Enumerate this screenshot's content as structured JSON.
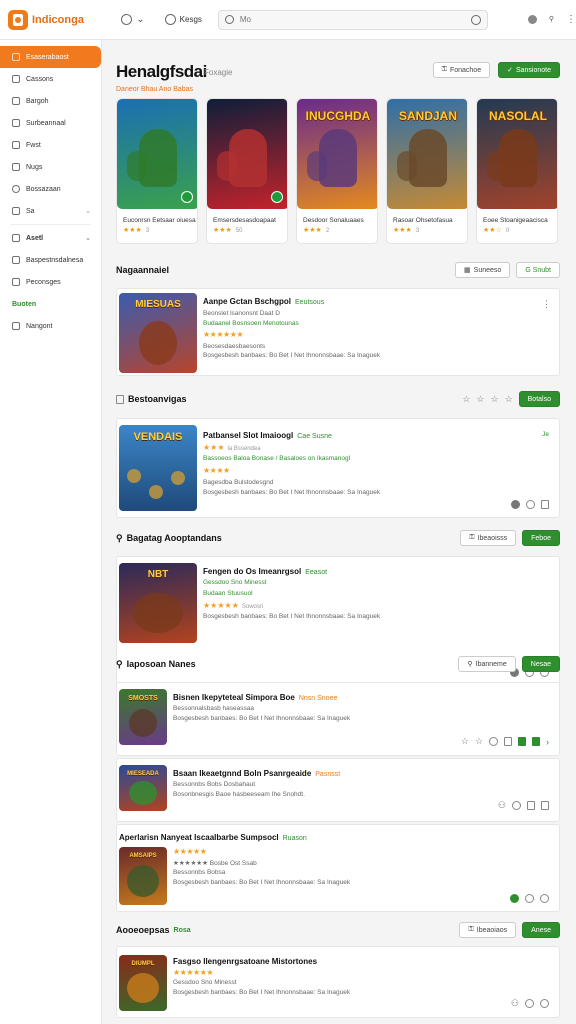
{
  "topbar": {
    "logo_text": "Indiconga",
    "nav1_label": "",
    "nav2_label": "Kesgs",
    "search_placeholder": "Mo"
  },
  "sidebar": {
    "items": [
      {
        "label": "Esaserabaost",
        "active": true
      },
      {
        "label": "Cassons"
      },
      {
        "label": "Bargoh"
      },
      {
        "label": "Surbeannaal"
      },
      {
        "label": "Fwst"
      },
      {
        "label": "Nugs"
      },
      {
        "label": "Bossazaan"
      },
      {
        "label": "Sa"
      },
      {
        "label": "Asetl"
      },
      {
        "label": "Baspestnsdalnesa"
      },
      {
        "label": "Peconsges"
      },
      {
        "label": "Buoten"
      },
      {
        "label": "Nangont"
      }
    ]
  },
  "hero": {
    "title": "Henalgfsdai",
    "subtitle": "Foxagie",
    "tagline": "Daneor Bhau Ano Babas",
    "action1": "Fonachoe",
    "action2": "Sansionote"
  },
  "carousel": [
    {
      "name": "Euconrsn Eetsaar oiuesa",
      "art_word": "",
      "rating": "3",
      "c1": "#1b6fb3",
      "c2": "#3aa14b",
      "f": "#2f7a2a"
    },
    {
      "name": "Emsersdesasdoapaat",
      "art_word": "",
      "rating": "50",
      "c1": "#0e1e3a",
      "c2": "#c4232b",
      "f": "#b33030"
    },
    {
      "name": "Desdoor Sonaluaaes",
      "art_word": "INUCGHDA",
      "rating": "2",
      "c1": "#6a2a8c",
      "c2": "#e38a1f",
      "f": "#5a3a7a"
    },
    {
      "name": "Rasoar Ohsetofasua",
      "art_word": "SANDJAN",
      "rating": "3",
      "c1": "#2f6fa8",
      "c2": "#c58a35",
      "f": "#6a4a2a"
    },
    {
      "name": "Eoee Stoanigeaacisca",
      "art_word": "NASOLAL",
      "rating": "0",
      "c1": "#233a52",
      "c2": "#a2432b",
      "f": "#7a3a1a"
    }
  ],
  "sections": [
    {
      "title": "Nagaannaiel",
      "action1": "Suneeso",
      "action2": "G Snubt",
      "items": [
        {
          "title": "Aanpe Gctan Bschgpol",
          "tag": "Eeutsous",
          "line1": "Beonslet lsanonsnt Daat D",
          "line2": "Budaanel Bosnsoen Menotounas",
          "stars": "★★★★★★",
          "line3": "Beosesdaesbaesonts",
          "line4": "Bosgesbesh banbaes: Bo Bet I Net Ihnonnsbaae: Sa Inaguek",
          "art_word": "MIESUAS"
        }
      ]
    },
    {
      "title": "Bestoanvigas",
      "action2": "Botalso",
      "items": [
        {
          "title": "Patbansel Slot Imaioogl",
          "tag": "Cae Susne",
          "right": "Je",
          "stars_a": "★★★",
          "line1": "la Bssendea",
          "line2": "Bassoeos Baloa Bonase / Basaloes on Ikasmanogl",
          "stars": "★★★★",
          "line3": "Bagesdba Bulstodesgnd",
          "line4": "Bosgesbesh banbaes: Bo Bet I Net Ihnonnsbaae: Sa Inaguek",
          "art_word": "VENDAIS"
        }
      ]
    },
    {
      "title": "Bagatag Aooptandans",
      "action1": "Ibeaoisss",
      "action2": "Feboe",
      "items": [
        {
          "title": "Fengen do Os Imeanrgsol",
          "tag": "Eeasot",
          "line1": "Gessdoo Sno Minesst",
          "line2": "Budaan Stuusuol",
          "stars": "★★★★★",
          "stars_note": "Sowosn",
          "line4": "Bosgesbesh banbaes: Bo Bet I Net Ihnonnsbaae: Sa Inaguek",
          "art_word": "NBT"
        }
      ]
    },
    {
      "title": "Iaposoan Nanes",
      "action1": "Ibanneme",
      "action2": "Nesae",
      "items": [
        {
          "title": "Bisnen Ikepyteteal Simpora Boe",
          "tag": "Nnsn Snoee",
          "line1": "Bessonnalsbasb haseassaa",
          "line2": "Bosgesbesh banbaes: Bo Bet I Net Ihnonnsbaae: Sa Inaguek",
          "art_word": "SMOSTS"
        },
        {
          "title": "Bsaan Ikeaetgnnd Boln Psanrgeaide",
          "tag": "Pasnsst",
          "line1": "Bessonnbs Bobs Dosbahaut",
          "line2": "Bosonbnesgis Baoe hasbeeseam Ihe Snohdt.",
          "art_word": "MIESEADA"
        },
        {
          "title": "Aperlarisn Nanyeat Iscaalbarbe Sumpsocl",
          "tag": "Ruason",
          "stars_a": "★★★★★",
          "line1": "★★★★★★ Bosbe Ost Ssab",
          "line2": "Bessonnbs Bobsa",
          "line3": "Bosgesbesh banbaes: Bo Bet I Net Ihnonnsbaae: Sa Inaguek",
          "art_word": "AMSAIPS"
        }
      ]
    },
    {
      "title": "Aooeoepsas",
      "tag": "Rosa",
      "action1": "Ibeaoiaos",
      "action2": "Anese",
      "items": [
        {
          "title": "Fasgso Ilengenrgsatoane Mistortones",
          "stars": "★★★★★★",
          "line1": "Gessdoo Sno Minesst",
          "line2": "Bosgesbesh banbaes: Bo Bet I Net Ihnonnsbaae: Sa Inaguek",
          "art_word": "DIUMPL"
        }
      ]
    }
  ],
  "colors": {
    "accent": "#f27a1e",
    "green": "#2f8f2f",
    "star": "#f0a022"
  }
}
